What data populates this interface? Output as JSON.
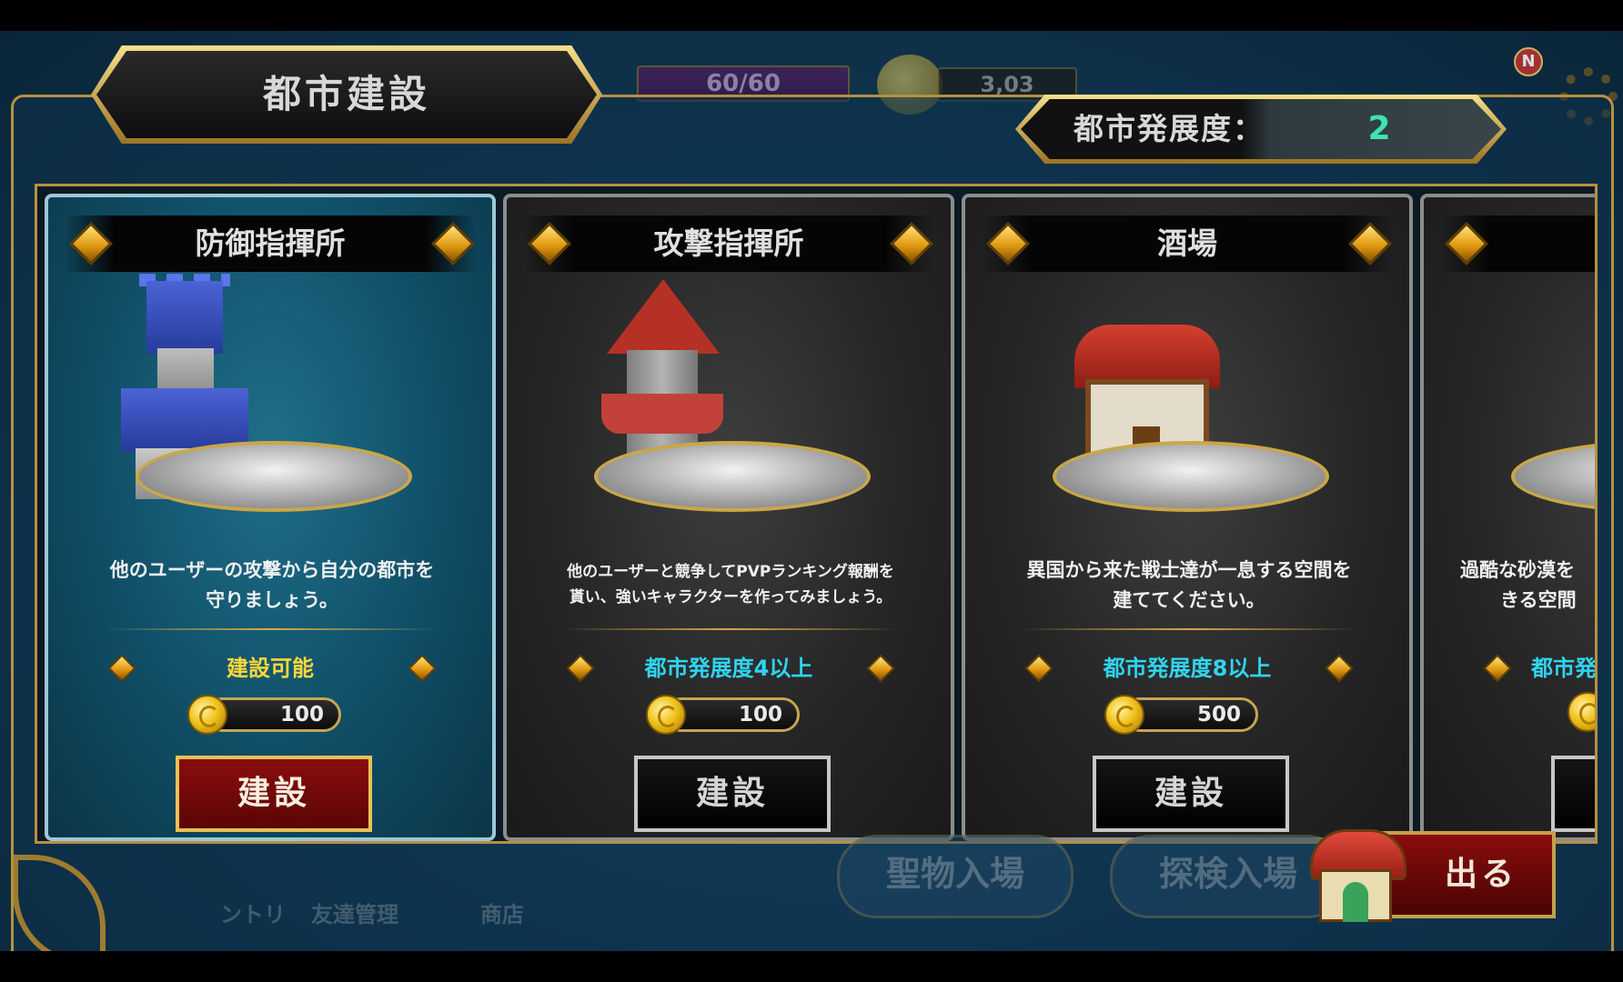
{
  "header": {
    "title": "都市建設",
    "development_label": "都市発展度：",
    "development_value": "2"
  },
  "background_status": {
    "stamina": "60/60",
    "gold": "3,03",
    "notice_badge": "N"
  },
  "cards": [
    {
      "name": "防御指揮所",
      "description_line1": "他のユーザーの攻撃から自分の都市を",
      "description_line2": "守りましょう。",
      "requirement": "建設可能",
      "cost": "100",
      "button": "建設",
      "icon": "blue-castle-tower"
    },
    {
      "name": "攻撃指揮所",
      "description_line1": "他のユーザーと競争してPVPランキング報酬を",
      "description_line2": "貰い、強いキャラクターを作ってみましょう。",
      "requirement": "都市発展度4以上",
      "cost": "100",
      "button": "建設",
      "icon": "red-watch-tower"
    },
    {
      "name": "酒場",
      "description_line1": "異国から来た戦士達が一息する空間を",
      "description_line2": "建ててください。",
      "requirement": "都市発展度8以上",
      "cost": "500",
      "button": "建設",
      "icon": "tavern-barn"
    },
    {
      "name": "",
      "description_line1": "過酷な砂漠を",
      "description_line2": "きる空間",
      "requirement": "都市発",
      "cost": "",
      "button": "",
      "icon": "partial-building"
    }
  ],
  "bottom_nav": {
    "items": [
      "ントリ",
      "友達管理",
      "商店"
    ],
    "relic_entry": "聖物入場",
    "explore_entry": "探検入場",
    "exit_button": "出る"
  },
  "colors": {
    "gold_border": "#b6913f",
    "requirement_ok": "#ffd83a",
    "requirement_locked": "#2fd5f0",
    "development_value": "#3ee3b8",
    "build_active": "#8a0d0d"
  }
}
